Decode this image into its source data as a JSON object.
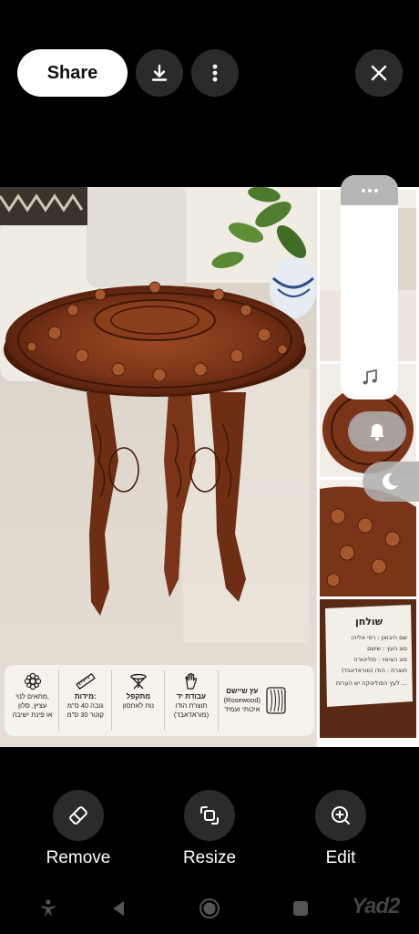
{
  "topbar": {
    "share_label": "Share",
    "download_icon": "download-icon",
    "more_icon": "more-vertical-icon",
    "close_icon": "close-icon"
  },
  "features": [
    {
      "title": "מתאים לנוי,",
      "lines": [
        "עציץ, סלון",
        "או פינת ישיבה"
      ],
      "icon": "flower-icon"
    },
    {
      "title": "מידות:",
      "lines": [
        "גובה 40 ס\"מ",
        "קוטר 30 ס\"מ"
      ],
      "icon": "ruler-icon"
    },
    {
      "title": "מתקפל",
      "lines": [
        "נוח לאחסון"
      ],
      "icon": "folding-stool-icon"
    },
    {
      "title": "עבודת יד",
      "lines": [
        "תוצרת הודו",
        "(מוראדאבד)"
      ],
      "icon": "hand-icon"
    },
    {
      "title": "עץ שיישם",
      "lines": [
        "(Rosewood)",
        "איכותי ועמיד"
      ],
      "icon": "wood-grain-icon"
    }
  ],
  "label_card": {
    "title": "שולחן",
    "lines": [
      "שם היבואן : רפי אליהו",
      "סוג העץ : שישם",
      "סוג הציפוי : פוליטורה",
      "תוצרת : הודו (מוראדאבד)",
      "לעץ הפוליסקה יש הערות ..."
    ]
  },
  "side_panel": {
    "handle_icon": "more-horizontal-icon",
    "music_icon": "music-note-icon",
    "bell_icon": "bell-icon",
    "moon_icon": "moon-icon"
  },
  "actions": [
    {
      "label": "Remove",
      "icon": "eraser-icon"
    },
    {
      "label": "Resize",
      "icon": "resize-icon"
    },
    {
      "label": "Edit",
      "icon": "edit-icon"
    }
  ],
  "navbar": {
    "watermark": "Yad2",
    "icons": [
      "accessibility-icon",
      "back-icon",
      "home-icon",
      "recents-icon"
    ]
  },
  "colors": {
    "background": "#000000",
    "button_dark": "#2b2b2b",
    "wood": "#7a3418",
    "feature_bar": "#f7f2ec"
  }
}
